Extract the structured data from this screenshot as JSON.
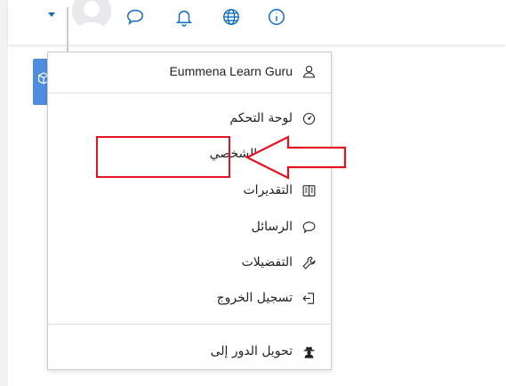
{
  "navbar": {
    "icons": [
      "user-avatar",
      "chat-icon",
      "bell-icon",
      "globe-icon",
      "info-icon"
    ]
  },
  "user_menu": {
    "username": "Eummena Learn Guru",
    "items": [
      {
        "label": "لوحة التحكم",
        "icon": "dashboard-icon"
      },
      {
        "label": "الملف الشخصي",
        "icon": "user-icon"
      },
      {
        "label": "التقديرات",
        "icon": "grades-icon"
      },
      {
        "label": "الرسائل",
        "icon": "message-icon"
      },
      {
        "label": "التفضيلات",
        "icon": "wrench-icon"
      },
      {
        "label": "تسجيل الخروج",
        "icon": "logout-icon"
      }
    ],
    "switch_role": {
      "label": "تحويل الدور إلى",
      "icon": "user-secret-icon"
    }
  },
  "annotation": {
    "highlight_color": "#e3141f",
    "highlighted_item": "الملف الشخصي"
  }
}
